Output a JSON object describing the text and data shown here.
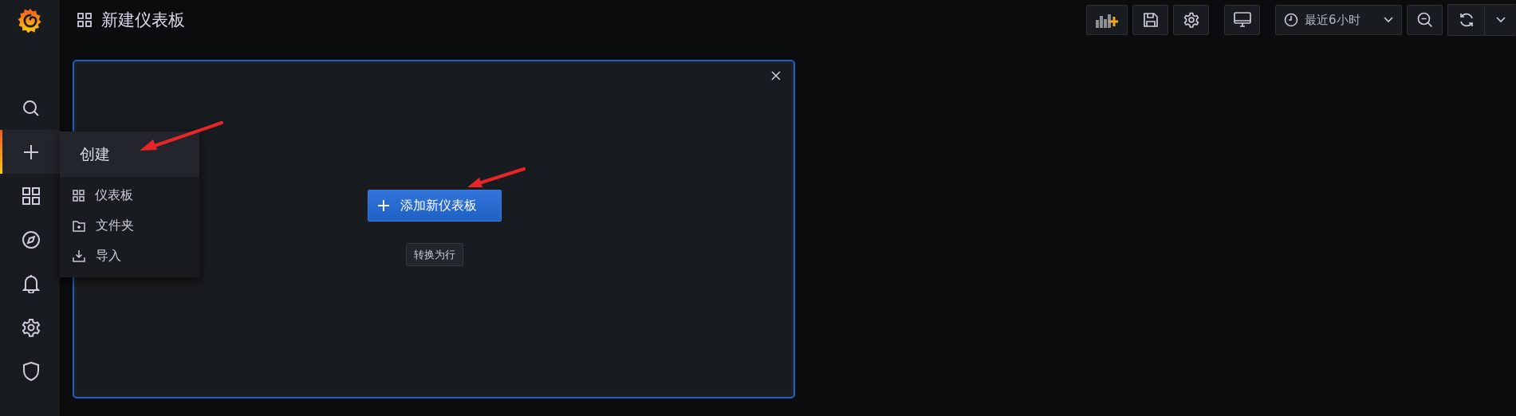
{
  "sidebar": {
    "items": [
      {
        "selected": false
      },
      {
        "selected": true
      },
      {
        "selected": false
      },
      {
        "selected": false
      },
      {
        "selected": false
      },
      {
        "selected": false
      },
      {
        "selected": false
      }
    ]
  },
  "create_menu": {
    "title": "创建",
    "items": [
      {
        "label": "仪表板"
      },
      {
        "label": "文件夹"
      },
      {
        "label": "导入"
      }
    ]
  },
  "header": {
    "title": "新建仪表板"
  },
  "toolbar": {
    "time_range": "最近6小时"
  },
  "panel": {
    "add_button": "添加新仪表板",
    "convert_button": "转换为行"
  }
}
